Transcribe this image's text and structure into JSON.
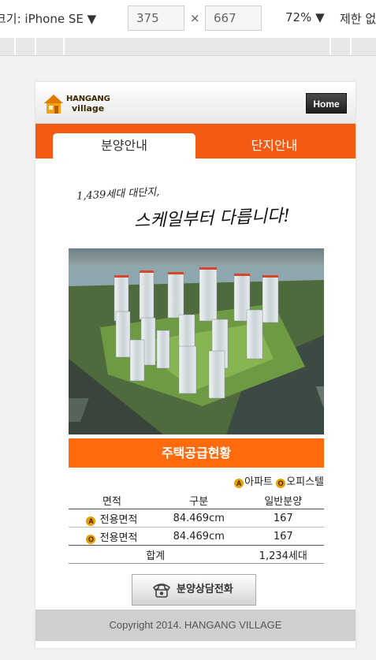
{
  "devtools": {
    "device_label": "크기: iPhone SE ▼",
    "width": "375",
    "times": "×",
    "height": "667",
    "zoom": "72% ▼",
    "throttle": "제한 없"
  },
  "header": {
    "logo_line1": "HANGANG",
    "logo_line2": "village",
    "home_label": "Home"
  },
  "tabs": [
    {
      "label": "분양안내",
      "active": true
    },
    {
      "label": "단지안내",
      "active": false
    }
  ],
  "slogan": {
    "line1": "1,439세대 대단지,",
    "line2": "스케일부터 다릅니다!"
  },
  "supply": {
    "title": "주택공급현황",
    "legend": [
      {
        "badge": "A",
        "label": "아파트"
      },
      {
        "badge": "O",
        "label": "오피스텔"
      }
    ],
    "columns": [
      "면적",
      "구분",
      "일반분양"
    ],
    "rows": [
      {
        "badge": "A",
        "area": "전용면적",
        "size": "84.469cm",
        "count": "167"
      },
      {
        "badge": "O",
        "area": "전용면적",
        "size": "84.469cm",
        "count": "167"
      }
    ],
    "total_label": "합계",
    "total_value": "1,234세대"
  },
  "consult_button": "분양상담전화",
  "footer": "Copyright 2014. HANGANG VILLAGE",
  "colors": {
    "accent": "#f35a13",
    "title_bar": "#ff6a0d",
    "badge": "#e8a000"
  }
}
